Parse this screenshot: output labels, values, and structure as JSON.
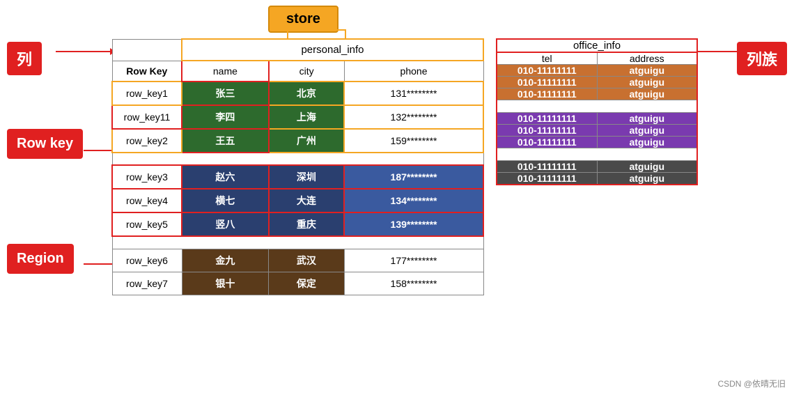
{
  "labels": {
    "lie": "列",
    "liezu": "列族",
    "rowkey": "Row key",
    "region": "Region",
    "store": "store",
    "personal_info": "personal_info",
    "office_info": "office_info"
  },
  "header_cols": {
    "row_key": "Row Key",
    "name": "name",
    "city": "city",
    "phone": "phone",
    "tel": "tel",
    "address": "address"
  },
  "rows": [
    {
      "key": "row_key1",
      "name": "张三",
      "city": "北京",
      "phone": "131********",
      "tel": "010-11111111",
      "address": "atguigu",
      "name_bg": "dark-green",
      "city_bg": "dark-green",
      "phone_bg": "white",
      "tel_bg": "orange",
      "addr_bg": "orange"
    },
    {
      "key": "row_key11",
      "name": "李四",
      "city": "上海",
      "phone": "132********",
      "tel": "010-11111111",
      "address": "atguigu",
      "name_bg": "dark-green",
      "city_bg": "dark-green",
      "phone_bg": "white",
      "tel_bg": "orange",
      "addr_bg": "orange"
    },
    {
      "key": "row_key2",
      "name": "王五",
      "city": "广州",
      "phone": "159********",
      "tel": "010-11111111",
      "address": "atguigu",
      "name_bg": "dark-green",
      "city_bg": "dark-green",
      "phone_bg": "white",
      "tel_bg": "orange",
      "addr_bg": "orange"
    },
    {
      "key": "row_key3",
      "name": "赵六",
      "city": "深圳",
      "phone": "187********",
      "tel": "010-11111111",
      "address": "atguigu",
      "name_bg": "dark-blue",
      "city_bg": "dark-blue",
      "phone_bg": "medium-blue",
      "tel_bg": "purple",
      "addr_bg": "purple"
    },
    {
      "key": "row_key4",
      "name": "横七",
      "city": "大连",
      "phone": "134********",
      "tel": "010-11111111",
      "address": "atguigu",
      "name_bg": "dark-blue",
      "city_bg": "dark-blue",
      "phone_bg": "medium-blue",
      "tel_bg": "purple",
      "addr_bg": "purple"
    },
    {
      "key": "row_key5",
      "name": "竖八",
      "city": "重庆",
      "phone": "139********",
      "tel": "010-11111111",
      "address": "atguigu",
      "name_bg": "dark-blue",
      "city_bg": "dark-blue",
      "phone_bg": "medium-blue",
      "tel_bg": "purple",
      "addr_bg": "purple"
    },
    {
      "key": "row_key6",
      "name": "金九",
      "city": "武汉",
      "phone": "177********",
      "tel": "010-11111111",
      "address": "atguigu",
      "name_bg": "dark-gray2",
      "city_bg": "dark-gray2",
      "phone_bg": "white2",
      "tel_bg": "dark-gray3",
      "addr_bg": "dark-gray3"
    },
    {
      "key": "row_key7",
      "name": "银十",
      "city": "保定",
      "phone": "158********",
      "tel": "010-11111111",
      "address": "atguigu",
      "name_bg": "dark-gray2",
      "city_bg": "dark-gray2",
      "phone_bg": "white2",
      "tel_bg": "dark-gray3",
      "addr_bg": "dark-gray3"
    }
  ],
  "watermark": "CSDN @依晴无旧"
}
